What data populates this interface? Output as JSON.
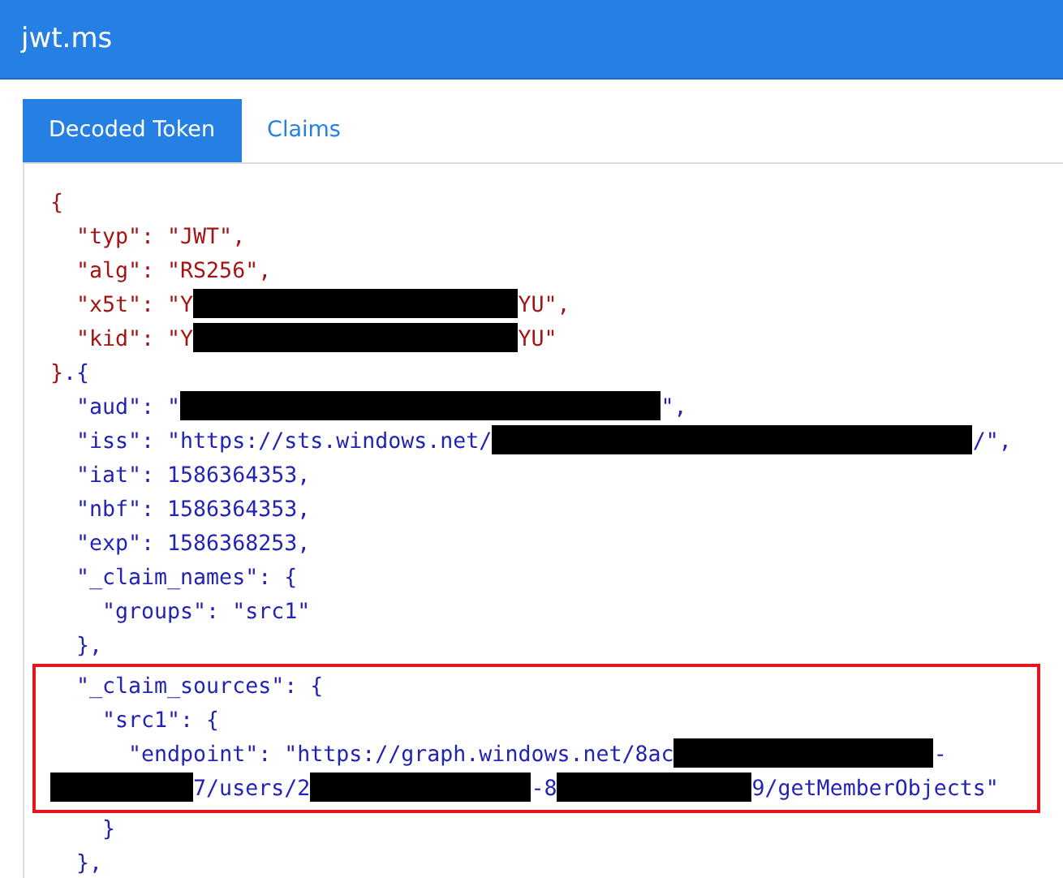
{
  "app": {
    "title": "jwt.ms"
  },
  "tabs": [
    {
      "label": "Decoded Token",
      "selected": true
    },
    {
      "label": "Claims",
      "selected": false
    }
  ],
  "code": [
    {
      "parts": [
        {
          "kind": "header_text",
          "text": "{"
        }
      ],
      "children": [
        {
          "parts": [
            {
              "kind": "header_text",
              "text": "\"typ\": \"JWT\","
            }
          ]
        },
        {
          "parts": [
            {
              "kind": "header_text",
              "text": "\"alg\": \"RS256\","
            }
          ]
        },
        {
          "parts": [
            {
              "kind": "header_text",
              "text": "\"x5t\": \"Y"
            },
            {
              "kind": "redacted"
            },
            {
              "kind": "header_text",
              "text": "YU\","
            }
          ]
        },
        {
          "parts": [
            {
              "kind": "header_text",
              "text": "\"kid\": \"Y"
            },
            {
              "kind": "redacted"
            },
            {
              "kind": "header_text",
              "text": "YU\""
            }
          ]
        }
      ]
    },
    {
      "parts": [
        {
          "kind": "header_text",
          "text": "}"
        },
        {
          "kind": "payload_text",
          "text": ".{"
        }
      ],
      "children": [
        {
          "parts": [
            {
              "kind": "payload_text",
              "text": "\"aud\": \""
            },
            {
              "kind": "redacted"
            },
            {
              "kind": "payload_text",
              "text": "\","
            }
          ]
        },
        {
          "parts": [
            {
              "kind": "payload_text",
              "text": "\"iss\": \"https://sts.windows.net/"
            },
            {
              "kind": "redacted"
            },
            {
              "kind": "payload_text",
              "text": "/\","
            }
          ]
        },
        {
          "parts": [
            {
              "kind": "payload_text",
              "text": "\"iat\": 1586364353,"
            }
          ]
        },
        {
          "parts": [
            {
              "kind": "payload_text",
              "text": "\"nbf\": 1586364353,"
            }
          ]
        },
        {
          "parts": [
            {
              "kind": "payload_text",
              "text": "\"exp\": 1586368253,"
            }
          ]
        },
        {
          "parts": [
            {
              "kind": "payload_text",
              "text": "\"_claim_names\": {"
            }
          ],
          "children": [
            {
              "parts": [
                {
                  "kind": "payload_text",
                  "text": "\"groups\": \"src1\""
                }
              ]
            }
          ]
        },
        {
          "parts": [
            {
              "kind": "payload_text",
              "text": "},"
            }
          ]
        },
        {
          "parts": [
            {
              "kind": "payload_text",
              "text": "\"_claim_sources\": {"
            }
          ],
          "highlighted": true,
          "children": [
            {
              "parts": [
                {
                  "kind": "payload_text",
                  "text": "\"src1\": {"
                }
              ],
              "highlighted": true,
              "children": [
                {
                  "parts": [
                    {
                      "kind": "payload_text",
                      "text": "\"endpoint\": \"https://graph.windows.net/8ac"
                    },
                    {
                      "kind": "redacted"
                    },
                    {
                      "kind": "payload_text",
                      "text": "-"
                    },
                    {
                      "kind": "break"
                    },
                    {
                      "kind": "redacted"
                    },
                    {
                      "kind": "payload_text",
                      "text": "7/users/2"
                    },
                    {
                      "kind": "redacted"
                    },
                    {
                      "kind": "payload_text",
                      "text": "-8"
                    },
                    {
                      "kind": "redacted"
                    },
                    {
                      "kind": "payload_text",
                      "text": "9/getMemberObjects\""
                    }
                  ],
                  "highlighted": true
                }
              ]
            },
            {
              "parts": [
                {
                  "kind": "payload_text",
                  "text": "}"
                }
              ]
            }
          ]
        },
        {
          "parts": [
            {
              "kind": "payload_text",
              "text": "},"
            }
          ]
        }
      ]
    }
  ]
}
